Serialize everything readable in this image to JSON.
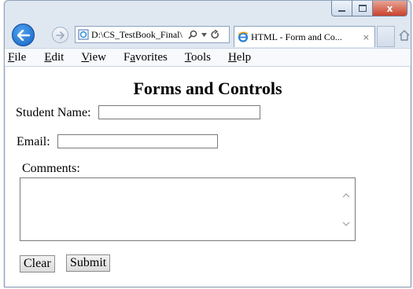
{
  "browser": {
    "address_text": "D:\\CS_TestBook_Final\\",
    "tab_title": "HTML - Form and Co...",
    "close_tab_glyph": "×",
    "caption_close_glyph": "x",
    "icons": [
      "back-arrow-icon",
      "forward-arrow-icon",
      "page-icon",
      "search-icon",
      "dropdown-icon",
      "refresh-icon",
      "ie-logo-icon",
      "home-icon"
    ]
  },
  "menu": {
    "items": [
      {
        "label": "File",
        "mnemonic": "F",
        "rest": "ile"
      },
      {
        "label": "Edit",
        "mnemonic": "E",
        "rest": "dit"
      },
      {
        "label": "View",
        "mnemonic": "V",
        "rest": "iew"
      },
      {
        "label": "Favorites",
        "pre": "F",
        "mnemonic": "a",
        "rest": "vorites"
      },
      {
        "label": "Tools",
        "mnemonic": "T",
        "rest": "ools"
      },
      {
        "label": "Help",
        "mnemonic": "H",
        "rest": "elp"
      }
    ]
  },
  "page": {
    "title": "Forms and Controls",
    "student_name_label": "Student Name:",
    "student_name_value": "",
    "email_label": "Email:",
    "email_value": "",
    "comments_label": "Comments:",
    "comments_value": "",
    "clear_label": "Clear",
    "submit_label": "Submit"
  },
  "colors": {
    "back_button": "#1a6ed0",
    "frame": "#dfe7f1",
    "close_button": "#c9432b"
  }
}
